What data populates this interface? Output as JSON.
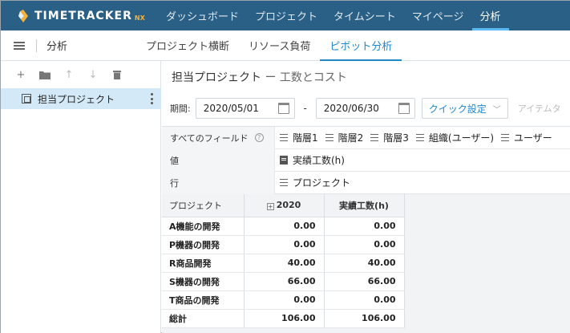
{
  "app": {
    "brand": "TIMETRACKER",
    "brand_suffix": "NX"
  },
  "nav": {
    "items": [
      {
        "label": "ダッシュボード",
        "active": false
      },
      {
        "label": "プロジェクト",
        "active": false
      },
      {
        "label": "タイムシート",
        "active": false
      },
      {
        "label": "マイページ",
        "active": false
      },
      {
        "label": "分析",
        "active": true
      }
    ]
  },
  "subbar": {
    "page_label": "分析",
    "tabs": [
      {
        "label": "プロジェクト横断",
        "active": false
      },
      {
        "label": "リソース負荷",
        "active": false
      },
      {
        "label": "ピボット分析",
        "active": true
      }
    ]
  },
  "sidebar": {
    "tools": [
      {
        "icon": "plus-icon",
        "glyph": "+"
      },
      {
        "icon": "folder-icon",
        "glyph": "▰"
      },
      {
        "icon": "arrow-up-icon",
        "glyph": "↑"
      },
      {
        "icon": "arrow-down-icon",
        "glyph": "↓"
      },
      {
        "icon": "trash-icon",
        "glyph": "■"
      }
    ],
    "selected_item": "担当プロジェクト"
  },
  "main": {
    "title": "担当プロジェクト",
    "title_sep": " ー ",
    "title_sub": "工数とコスト",
    "period_label": "期間:",
    "date_from": "2020/05/01",
    "date_sep": "-",
    "date_to": "2020/06/30",
    "quick_label": "クイック設定",
    "item_label": "アイテムタ",
    "fields": {
      "all_fields_label": "すべてのフィールド",
      "all_fields": [
        "階層1",
        "階層2",
        "階層3",
        "組織(ユーザー)",
        "ユーザー"
      ],
      "values_label": "値",
      "values": "実績工数(h)",
      "rows_label": "行",
      "rows": "プロジェクト"
    }
  },
  "pivot": {
    "headers": {
      "project": "プロジェクト",
      "year": "2020",
      "value": "実績工数(h)"
    },
    "rows": [
      {
        "name": "A機能の開発",
        "year": "0.00",
        "value": "0.00"
      },
      {
        "name": "P機器の開発",
        "year": "0.00",
        "value": "0.00"
      },
      {
        "name": "R商品開発",
        "year": "40.00",
        "value": "40.00"
      },
      {
        "name": "S機器の開発",
        "year": "66.00",
        "value": "66.00"
      },
      {
        "name": "T商品の開発",
        "year": "0.00",
        "value": "0.00"
      },
      {
        "name": "総計",
        "year": "106.00",
        "value": "106.00"
      }
    ]
  }
}
